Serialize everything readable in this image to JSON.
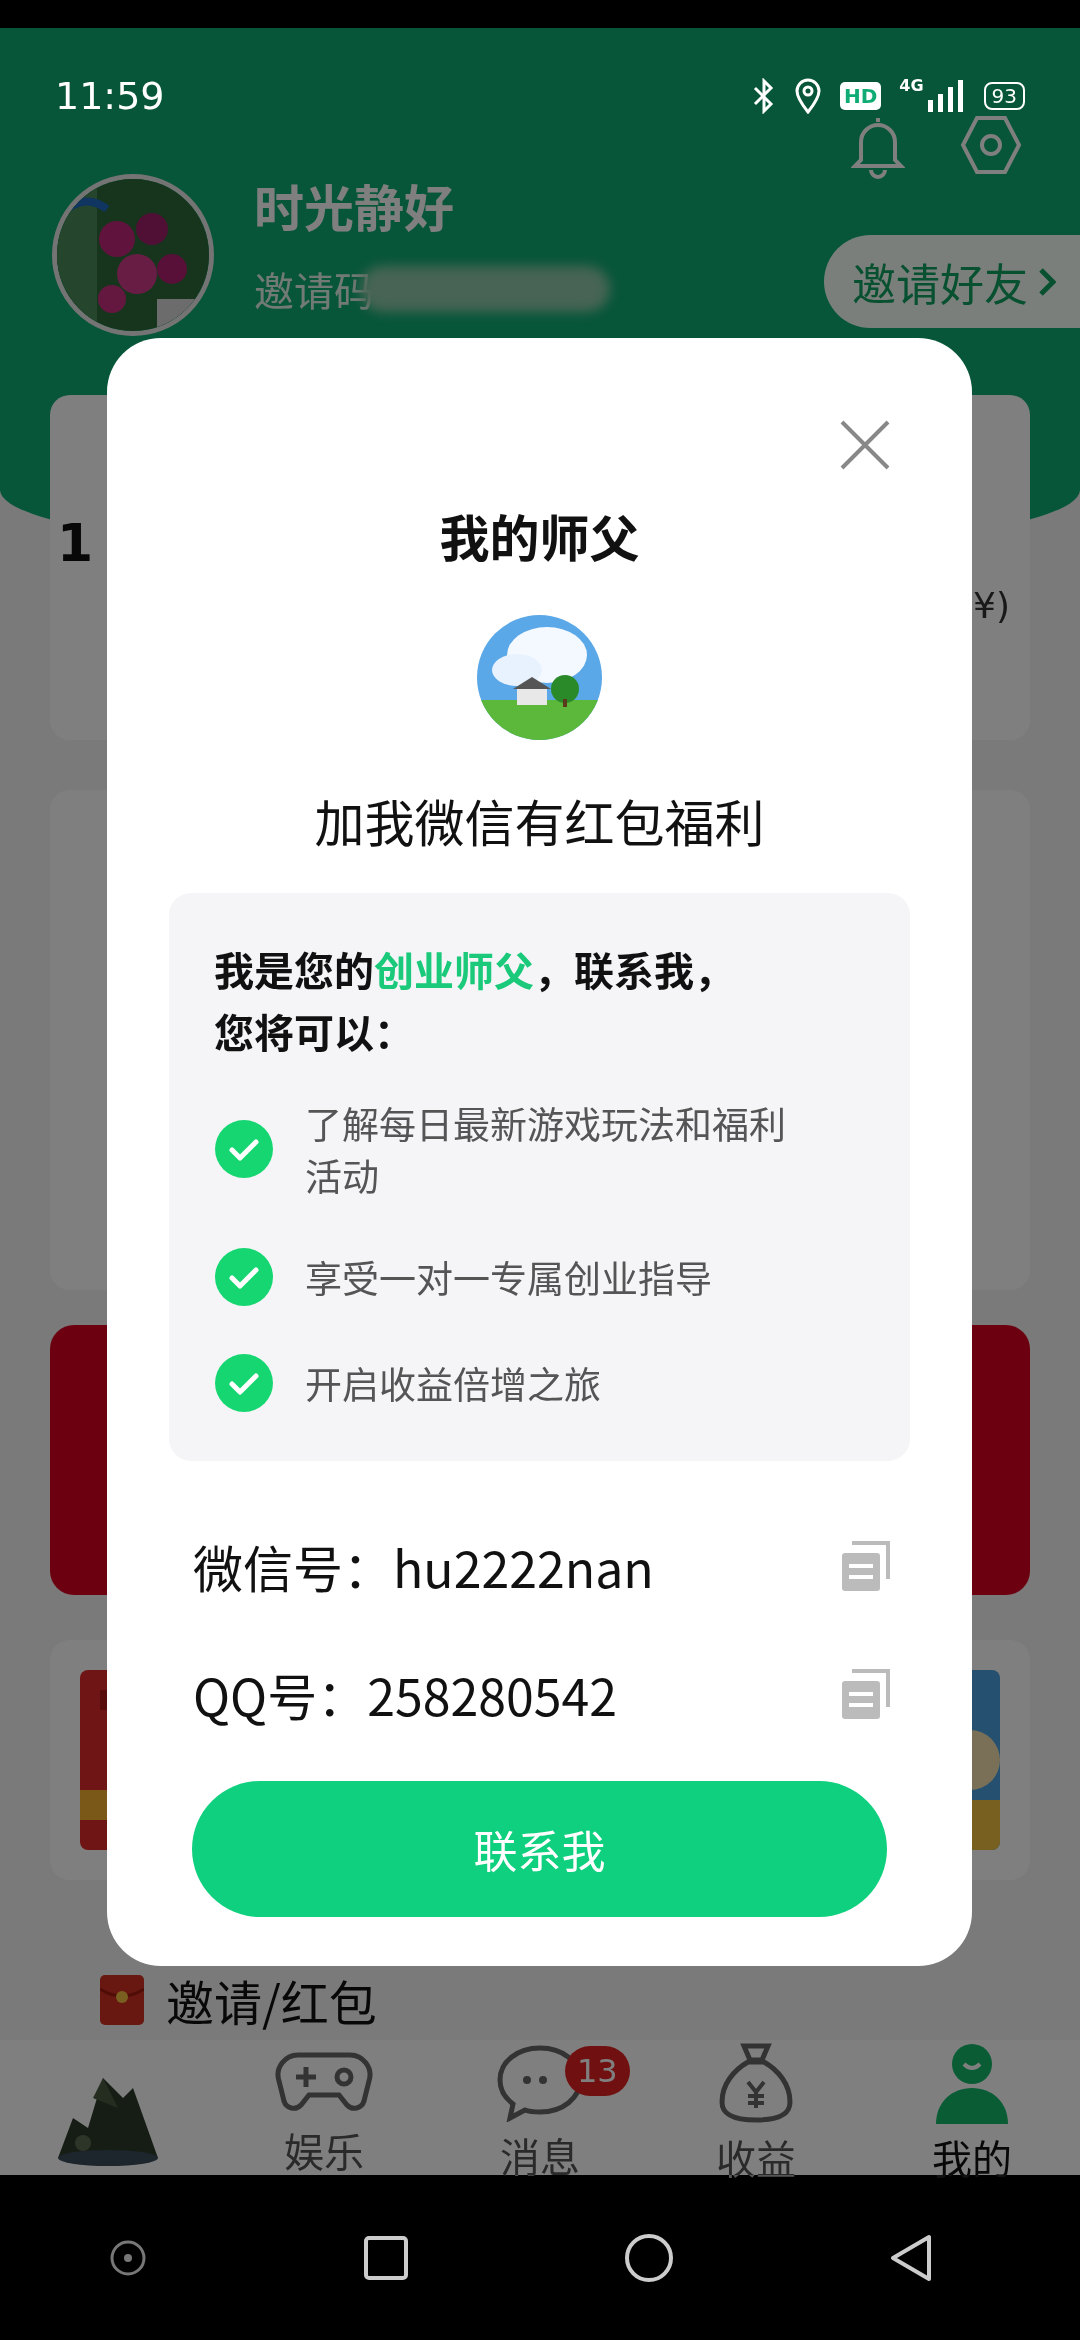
{
  "status_bar": {
    "time": "11:59",
    "hd": "HD",
    "network": "4G",
    "battery": "93"
  },
  "profile": {
    "name": "时光静好",
    "invite_code_label": "邀请码",
    "invite_button": "邀请好友"
  },
  "stats_card": {
    "value_fragment": "1",
    "unit": "¥)"
  },
  "section": {
    "title": "邀请/红包"
  },
  "bottom_nav": [
    {
      "kind": "picture"
    },
    {
      "kind": "tab",
      "label": "娱乐",
      "selected": false
    },
    {
      "kind": "tab",
      "label": "消息",
      "badge": "13",
      "selected": false
    },
    {
      "kind": "tab",
      "label": "收益",
      "selected": false
    },
    {
      "kind": "tab",
      "label": "我的",
      "selected": true
    }
  ],
  "dialog": {
    "title": "我的师父",
    "subtitle": "加我微信有红包福利",
    "intro": [
      {
        "text": "我是您的",
        "highlight": false
      },
      {
        "text": "创业师父",
        "highlight": true
      },
      {
        "text": "，联系我，您将可以：",
        "highlight": false
      }
    ],
    "benefits": [
      {
        "text": "了解每日最新游戏玩法和福利活动",
        "checked": true
      },
      {
        "text": "享受一对一专属创业指导",
        "checked": true
      },
      {
        "text": "开启收益倍增之旅",
        "checked": true
      }
    ],
    "contacts": [
      {
        "text": "微信号：hu2222nan"
      },
      {
        "text": "QQ号：258280542"
      }
    ],
    "button": "联系我"
  }
}
